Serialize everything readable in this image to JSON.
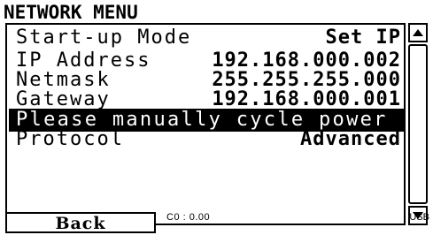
{
  "title": "NETWORK MENU",
  "rows": [
    {
      "label": "Start-up Mode",
      "value": "Set IP"
    },
    {
      "label": "IP Address",
      "value": "192.168.000.002"
    },
    {
      "label": "Netmask",
      "value": "255.255.255.000"
    },
    {
      "label": "Gateway",
      "value": "192.168.000.001"
    },
    {
      "label": "Please manually cycle power",
      "value": ""
    },
    {
      "label": "Protocol",
      "value": "Advanced"
    }
  ],
  "back_label": "Back",
  "status_text": "C0 : 0.00",
  "usb_label": "USB",
  "icons": {
    "scroll_up": "arrow-up-icon",
    "scroll_down": "arrow-down-icon"
  }
}
